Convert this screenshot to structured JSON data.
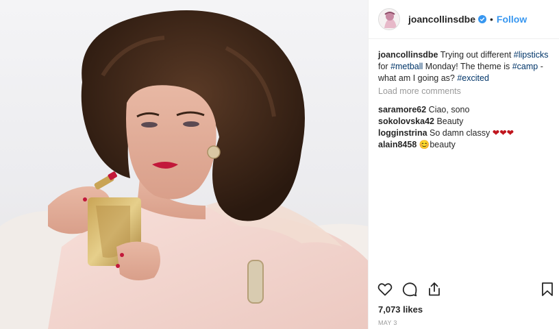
{
  "post": {
    "image_alt": "Woman with voluminous dark curls applying red lipstick while holding a gold compact"
  },
  "header": {
    "username": "joancollinsdbe",
    "separator": "•",
    "follow_label": "Follow"
  },
  "caption": {
    "username": "joancollinsdbe",
    "parts": [
      {
        "text": " Trying out different ",
        "type": "text"
      },
      {
        "text": "#lipsticks",
        "type": "tag"
      },
      {
        "text": " for ",
        "type": "text"
      },
      {
        "text": "#metball",
        "type": "tag"
      },
      {
        "text": " Monday! The theme is ",
        "type": "text"
      },
      {
        "text": "#camp",
        "type": "tag"
      },
      {
        "text": " - what am I going as? ",
        "type": "text"
      },
      {
        "text": "#excited",
        "type": "tag"
      }
    ]
  },
  "load_more": "Load more comments",
  "comments": [
    {
      "username": "saramore62",
      "text": " Ciao, sono"
    },
    {
      "username": "sokolovska42",
      "text": " Beauty"
    },
    {
      "username": "logginstrina",
      "text": " So damn classy ❤❤❤"
    },
    {
      "username": "alain8458",
      "text": " 😊beauty"
    }
  ],
  "likes": "7,073 likes",
  "date": "MAY 3",
  "colors": {
    "link_blue": "#3897f0",
    "hashtag": "#003569",
    "muted": "#999999",
    "heart_red": "#c0161e"
  },
  "icons": [
    "heart-icon",
    "comment-icon",
    "share-icon",
    "bookmark-icon",
    "verified-badge-icon"
  ]
}
